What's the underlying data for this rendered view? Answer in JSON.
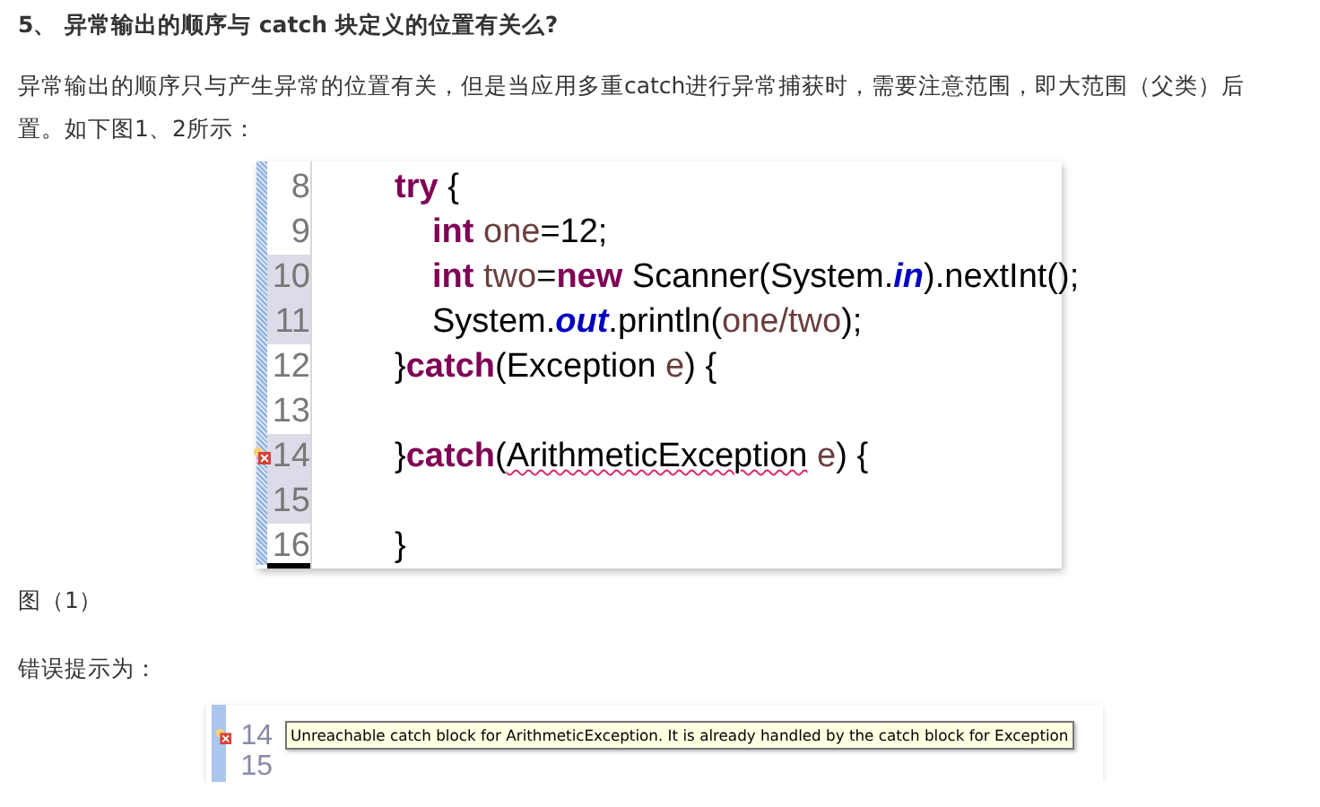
{
  "heading": "5、 异常输出的顺序与 catch 块定义的位置有关么?",
  "paragraph": "异常输出的顺序只与产生异常的位置有关，但是当应用多重catch进行异常捕获时，需要注意范围，即大范围（父类）后置。如下图1、2所示：",
  "figure_1": {
    "lines": [
      {
        "number": "8",
        "highlighted": false,
        "error": false,
        "kind": "outer",
        "tokens": [
          {
            "kind": "keyword",
            "text": "try"
          },
          {
            "kind": "plain",
            "text": " {"
          }
        ]
      },
      {
        "number": "9",
        "highlighted": false,
        "error": false,
        "kind": "inner",
        "tokens": [
          {
            "kind": "keyword",
            "text": "int"
          },
          {
            "kind": "variable",
            "text": " one"
          },
          {
            "kind": "plain",
            "text": "=12;"
          }
        ]
      },
      {
        "number": "10",
        "highlighted": true,
        "error": false,
        "kind": "inner",
        "tokens": [
          {
            "kind": "keyword",
            "text": "int"
          },
          {
            "kind": "variable",
            "text": " two"
          },
          {
            "kind": "plain",
            "text": "="
          },
          {
            "kind": "keyword",
            "text": "new"
          },
          {
            "kind": "plain",
            "text": " Scanner(System."
          },
          {
            "kind": "field",
            "text": "in"
          },
          {
            "kind": "plain",
            "text": ").nextInt();"
          }
        ]
      },
      {
        "number": "11",
        "highlighted": true,
        "error": false,
        "kind": "inner",
        "tokens": [
          {
            "kind": "plain",
            "text": "System."
          },
          {
            "kind": "field",
            "text": "out"
          },
          {
            "kind": "plain",
            "text": ".println("
          },
          {
            "kind": "variable",
            "text": "one/two"
          },
          {
            "kind": "plain",
            "text": ");"
          }
        ]
      },
      {
        "number": "12",
        "highlighted": false,
        "error": false,
        "kind": "outer",
        "tokens": [
          {
            "kind": "plain",
            "text": "}"
          },
          {
            "kind": "keyword",
            "text": "catch"
          },
          {
            "kind": "plain",
            "text": "(Exception "
          },
          {
            "kind": "variable",
            "text": "e"
          },
          {
            "kind": "plain",
            "text": ") {"
          }
        ]
      },
      {
        "number": "13",
        "highlighted": false,
        "error": false,
        "kind": "outer"
      },
      {
        "number": "14",
        "highlighted": true,
        "error": true,
        "kind": "outer",
        "tokens": [
          {
            "kind": "plain",
            "text": "}"
          },
          {
            "kind": "keyword",
            "text": "catch"
          },
          {
            "kind": "plain",
            "text": "("
          },
          {
            "kind": "error",
            "text": "ArithmeticException"
          },
          {
            "kind": "variable",
            "text": " e"
          },
          {
            "kind": "plain",
            "text": ") {"
          }
        ]
      },
      {
        "number": "15",
        "highlighted": true,
        "error": false,
        "kind": "outer"
      },
      {
        "number": "16",
        "highlighted": false,
        "error": false,
        "kind": "outer",
        "tokens": [
          {
            "kind": "plain",
            "text": "}"
          }
        ]
      }
    ]
  },
  "caption_1": "图（1）",
  "error_label": "错误提示为：",
  "figure_2": {
    "numbers": [
      "14",
      "15"
    ],
    "tooltip": "Unreachable catch block for ArithmeticException. It is already handled by the catch block for Exception"
  }
}
